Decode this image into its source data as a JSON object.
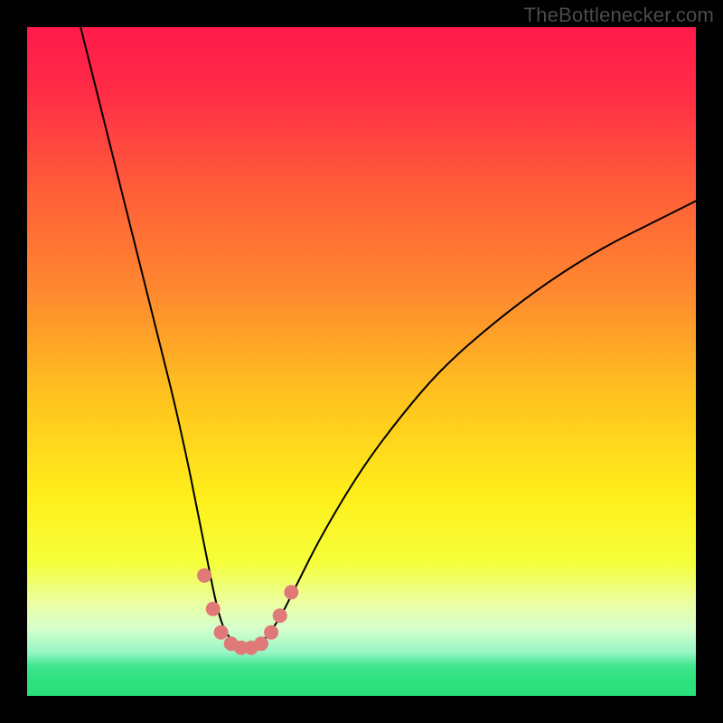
{
  "watermark": "TheBottlenecker.com",
  "chart_data": {
    "type": "line",
    "title": "",
    "xlabel": "",
    "ylabel": "",
    "xlim": [
      0,
      100
    ],
    "ylim": [
      0,
      100
    ],
    "background_gradient_stops": [
      {
        "offset": 0.0,
        "color": "#ff1a4a"
      },
      {
        "offset": 0.1,
        "color": "#ff2d46"
      },
      {
        "offset": 0.25,
        "color": "#ff6038"
      },
      {
        "offset": 0.4,
        "color": "#ff8a2f"
      },
      {
        "offset": 0.55,
        "color": "#ffc21f"
      },
      {
        "offset": 0.7,
        "color": "#ffee1a"
      },
      {
        "offset": 0.8,
        "color": "#f5ff3a"
      },
      {
        "offset": 0.86,
        "color": "#ecffa0"
      },
      {
        "offset": 0.9,
        "color": "#d5ffcd"
      },
      {
        "offset": 0.935,
        "color": "#97f6c6"
      },
      {
        "offset": 0.955,
        "color": "#40e68e"
      },
      {
        "offset": 0.975,
        "color": "#2de27e"
      },
      {
        "offset": 1.0,
        "color": "#28e07a"
      }
    ],
    "series": [
      {
        "name": "bottleneck-curve",
        "color": "#000000",
        "stroke_width": 2,
        "x": [
          8,
          10,
          12,
          14,
          16,
          18,
          20,
          22,
          24,
          25,
          26,
          27,
          28,
          29,
          30,
          31,
          32,
          33,
          34,
          35,
          36,
          38,
          40,
          44,
          50,
          56,
          62,
          70,
          78,
          86,
          94,
          100
        ],
        "y": [
          100,
          92,
          84,
          76,
          68,
          60,
          52,
          44,
          35,
          30,
          25,
          20,
          15,
          11,
          9,
          8,
          7,
          7,
          7,
          8,
          9,
          12,
          16,
          24,
          34,
          42,
          49,
          56,
          62,
          67,
          71,
          74
        ]
      }
    ],
    "markers": {
      "name": "highlight-beads",
      "color": "#e07a78",
      "radius": 8,
      "points": [
        {
          "x": 26.5,
          "y": 18
        },
        {
          "x": 27.8,
          "y": 13
        },
        {
          "x": 29.0,
          "y": 9.5
        },
        {
          "x": 30.5,
          "y": 7.8
        },
        {
          "x": 32.0,
          "y": 7.2
        },
        {
          "x": 33.5,
          "y": 7.2
        },
        {
          "x": 35.0,
          "y": 7.8
        },
        {
          "x": 36.5,
          "y": 9.5
        },
        {
          "x": 37.8,
          "y": 12
        },
        {
          "x": 39.5,
          "y": 15.5
        }
      ]
    }
  }
}
